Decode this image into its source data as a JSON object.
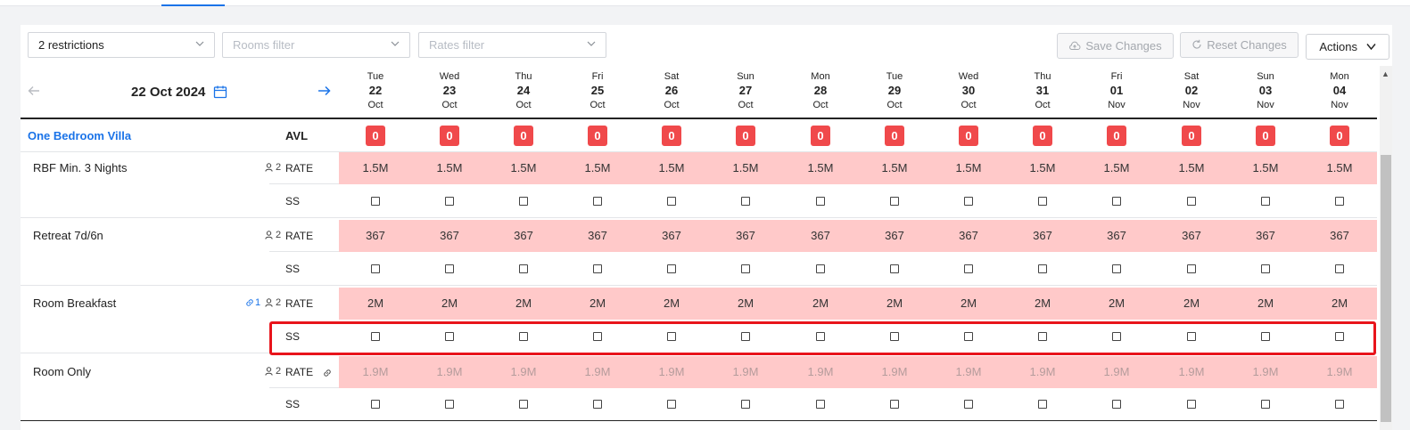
{
  "toolbar": {
    "restrictions": "2 restrictions",
    "rooms_filter_placeholder": "Rooms filter",
    "rates_filter_placeholder": "Rates filter",
    "save_label": "Save Changes",
    "reset_label": "Reset Changes",
    "actions_label": "Actions"
  },
  "datenav": {
    "current_date": "22 Oct 2024",
    "prev_icon": "arrow-left-icon",
    "next_icon": "arrow-right-icon",
    "calendar_icon": "calendar-icon"
  },
  "days": [
    {
      "dow": "Tue",
      "day": "22",
      "month": "Oct"
    },
    {
      "dow": "Wed",
      "day": "23",
      "month": "Oct"
    },
    {
      "dow": "Thu",
      "day": "24",
      "month": "Oct"
    },
    {
      "dow": "Fri",
      "day": "25",
      "month": "Oct"
    },
    {
      "dow": "Sat",
      "day": "26",
      "month": "Oct"
    },
    {
      "dow": "Sun",
      "day": "27",
      "month": "Oct"
    },
    {
      "dow": "Mon",
      "day": "28",
      "month": "Oct"
    },
    {
      "dow": "Tue",
      "day": "29",
      "month": "Oct"
    },
    {
      "dow": "Wed",
      "day": "30",
      "month": "Oct"
    },
    {
      "dow": "Thu",
      "day": "31",
      "month": "Oct"
    },
    {
      "dow": "Fri",
      "day": "01",
      "month": "Nov"
    },
    {
      "dow": "Sat",
      "day": "02",
      "month": "Nov"
    },
    {
      "dow": "Sun",
      "day": "03",
      "month": "Nov"
    },
    {
      "dow": "Mon",
      "day": "04",
      "month": "Nov"
    }
  ],
  "room": {
    "name": "One Bedroom Villa",
    "avl_label": "AVL",
    "availability": [
      "0",
      "0",
      "0",
      "0",
      "0",
      "0",
      "0",
      "0",
      "0",
      "0",
      "0",
      "0",
      "0",
      "0"
    ]
  },
  "rate_label": "RATE",
  "ss_label": "SS",
  "plans": [
    {
      "name": "RBF Min. 3 Nights",
      "occupancy": "2",
      "linked_count": "",
      "rate_linked": false,
      "rates": [
        "1.5M",
        "1.5M",
        "1.5M",
        "1.5M",
        "1.5M",
        "1.5M",
        "1.5M",
        "1.5M",
        "1.5M",
        "1.5M",
        "1.5M",
        "1.5M",
        "1.5M",
        "1.5M"
      ]
    },
    {
      "name": "Retreat 7d/6n",
      "occupancy": "2",
      "linked_count": "",
      "rate_linked": false,
      "rates": [
        "367",
        "367",
        "367",
        "367",
        "367",
        "367",
        "367",
        "367",
        "367",
        "367",
        "367",
        "367",
        "367",
        "367"
      ]
    },
    {
      "name": "Room Breakfast",
      "occupancy": "2",
      "linked_count": "1",
      "rate_linked": false,
      "rates": [
        "2M",
        "2M",
        "2M",
        "2M",
        "2M",
        "2M",
        "2M",
        "2M",
        "2M",
        "2M",
        "2M",
        "2M",
        "2M",
        "2M"
      ]
    },
    {
      "name": "Room Only",
      "occupancy": "2",
      "linked_count": "",
      "rate_linked": true,
      "rates": [
        "1.9M",
        "1.9M",
        "1.9M",
        "1.9M",
        "1.9M",
        "1.9M",
        "1.9M",
        "1.9M",
        "1.9M",
        "1.9M",
        "1.9M",
        "1.9M",
        "1.9M",
        "1.9M"
      ]
    }
  ],
  "colors": {
    "accent": "#1a73e8",
    "rate_band": "#ffc9c9",
    "badge": "#f0494b",
    "highlight": "#e8141b"
  }
}
